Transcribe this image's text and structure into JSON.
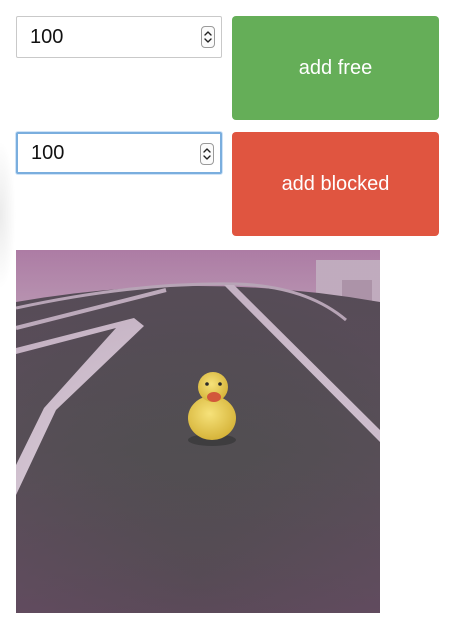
{
  "controls": {
    "free": {
      "input_value": "100",
      "button_label": "add free"
    },
    "blocked": {
      "input_value": "100",
      "button_label": "add blocked"
    }
  },
  "icons": {
    "stepper": "up-down-stepper-icon"
  },
  "colors": {
    "free_button": "#65ae58",
    "blocked_button": "#e05540",
    "focus_border": "#7aaede"
  },
  "camera": {
    "subject": "rubber-duck"
  }
}
